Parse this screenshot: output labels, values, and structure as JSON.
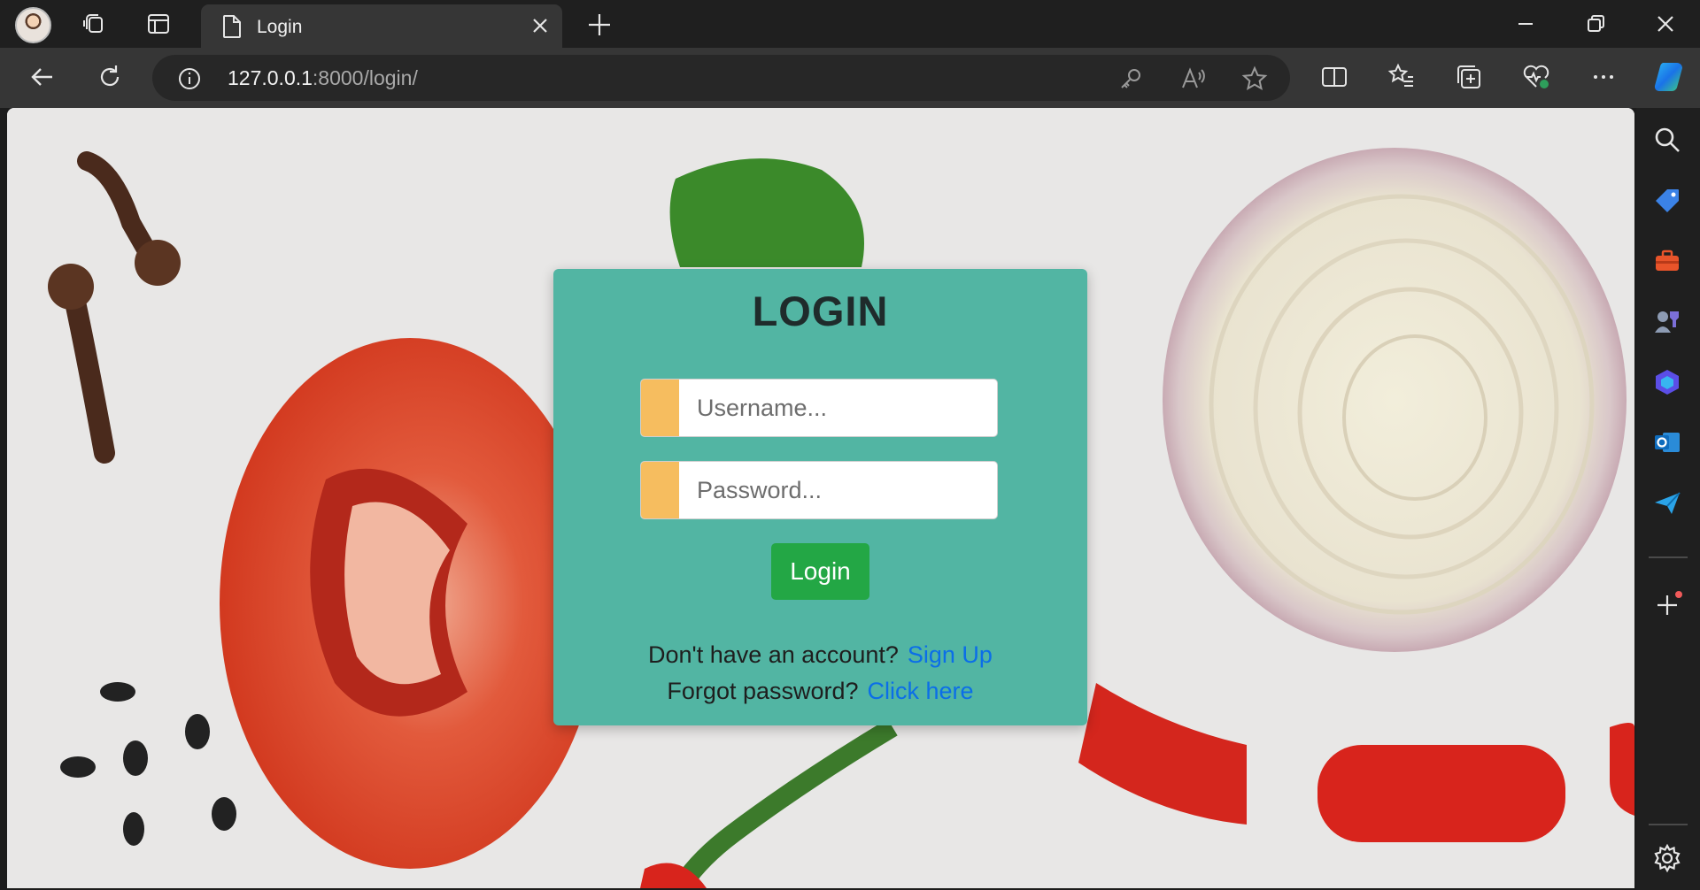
{
  "browser": {
    "tab_title": "Login",
    "url_host": "127.0.0.1",
    "url_path": ":8000/login/"
  },
  "icons": {
    "tab_bar": [
      "workspaces-icon",
      "tab-actions-icon"
    ],
    "omnibox": [
      "key-icon",
      "read-aloud-icon",
      "favorite-star-icon"
    ],
    "toolbar": [
      "split-screen-icon",
      "favorites-icon",
      "collections-icon",
      "browser-essentials-icon",
      "more-icon",
      "copilot-icon"
    ],
    "sidebar": [
      "search-icon",
      "shopping-tag-icon",
      "tools-icon",
      "games-icon",
      "copilot-sidebar-icon",
      "outlook-icon",
      "send-icon",
      "add-icon",
      "settings-icon"
    ]
  },
  "login": {
    "heading": "LOGIN",
    "username_placeholder": "Username...",
    "password_placeholder": "Password...",
    "button_label": "Login",
    "signup_prompt": "Don't have an account?",
    "signup_link": "Sign Up",
    "forgot_prompt": "Forgot password?",
    "forgot_link": "Click here"
  },
  "colors": {
    "card_bg": "#52b5a3",
    "input_accent": "#f6bd5f",
    "button_bg": "#23a745",
    "link": "#0b6ee8"
  }
}
